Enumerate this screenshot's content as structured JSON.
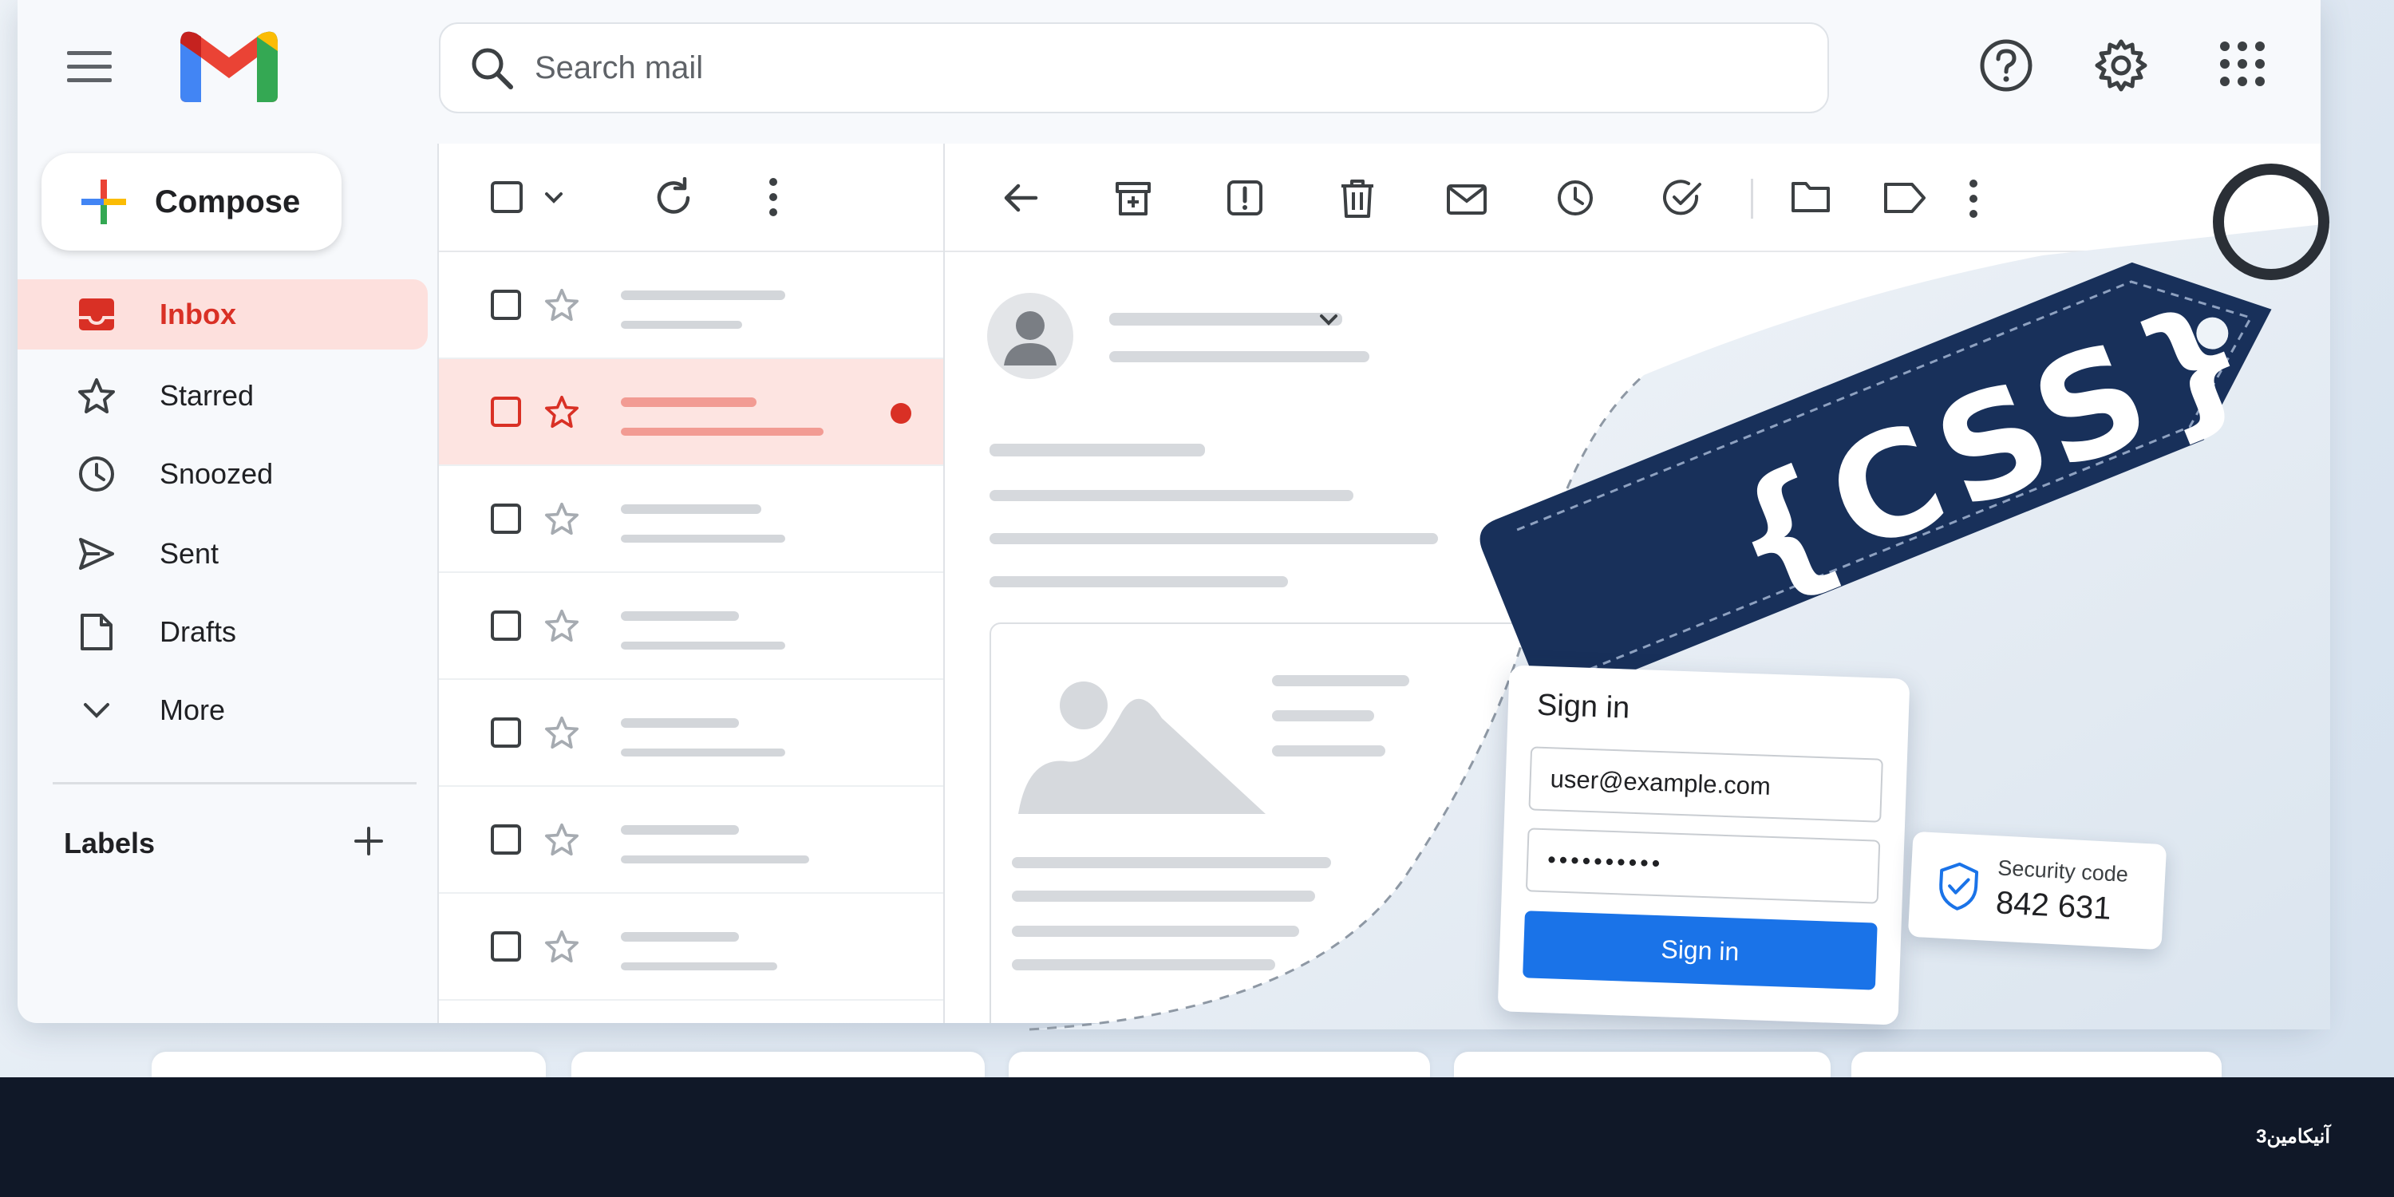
{
  "search": {
    "placeholder": "Search mail",
    "icon": "search-icon"
  },
  "header": {
    "icons": [
      "help-icon",
      "settings-icon",
      "apps-grid-icon"
    ]
  },
  "sidebar": {
    "compose_label": "Compose",
    "items": [
      {
        "label": "Inbox",
        "icon": "inbox-icon",
        "active": true
      },
      {
        "label": "Starred",
        "icon": "star-icon"
      },
      {
        "label": "Snoozed",
        "icon": "clock-icon"
      },
      {
        "label": "Sent",
        "icon": "send-icon"
      },
      {
        "label": "Drafts",
        "icon": "draft-icon"
      },
      {
        "label": "More",
        "icon": "chevron-down-icon"
      }
    ],
    "labels_title": "Labels"
  },
  "mail_list": {
    "unread_selected_row": 2,
    "row_count": 7
  },
  "tag": {
    "text": "{CSS}",
    "color": "#18305a"
  },
  "signin_card": {
    "title": "Sign in",
    "email": "user@example.com",
    "password": "••••••••••",
    "button": "Sign in"
  },
  "security_card": {
    "label": "Security code",
    "code": "842 631"
  },
  "footer": {
    "brand": "آنیکامین3"
  },
  "colors": {
    "accent_red": "#d93025",
    "primary_blue": "#1a73e8",
    "footer_bg": "#101828",
    "selected_row": "#fde4e1"
  }
}
